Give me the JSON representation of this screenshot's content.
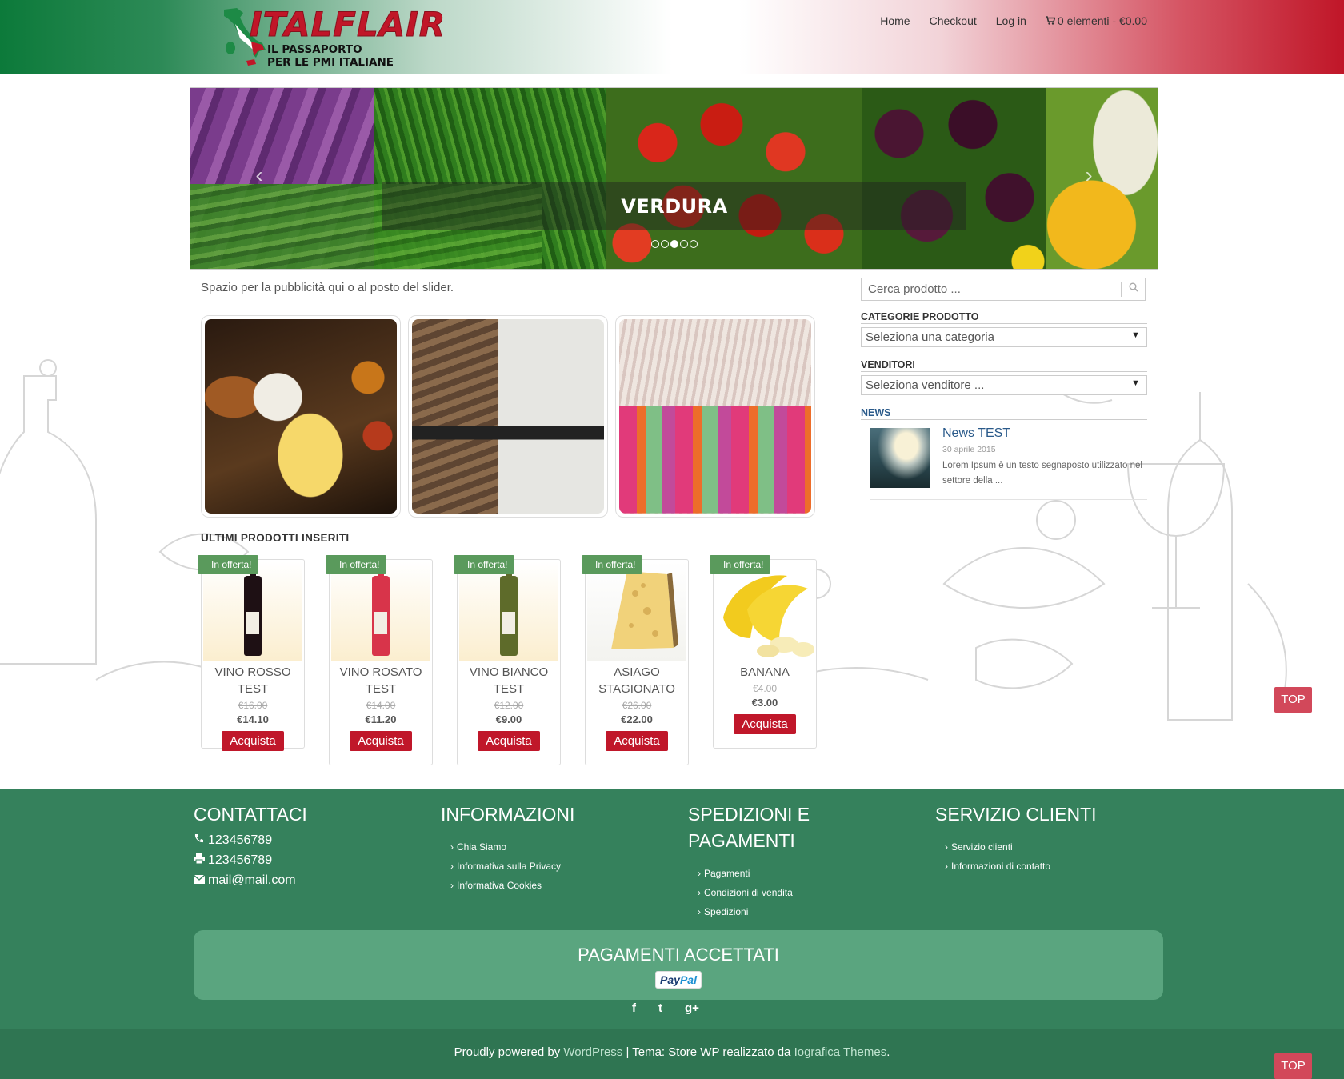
{
  "header": {
    "logo_title": "ITALFLAIR",
    "logo_sub1": "IL PASSAPORTO",
    "logo_sub2": "PER LE PMI ITALIANE",
    "nav": {
      "home": "Home",
      "checkout": "Checkout",
      "login": "Log in",
      "cart": "0 elementi - €0.00"
    }
  },
  "slider": {
    "caption": "VERDURA",
    "prev": "‹",
    "next": "›",
    "dots": 5,
    "active_dot": 3
  },
  "main": {
    "ad_text": "Spazio per la pubblicità qui o al posto del slider.",
    "section_title": "ULTIMI PRODOTTI INSERITI",
    "products": [
      {
        "badge": "In offerta!",
        "name": "VINO ROSSO TEST",
        "old_price": "€16.00",
        "price": "€14.10",
        "button": "Acquista"
      },
      {
        "badge": "In offerta!",
        "name": "VINO ROSATO TEST",
        "old_price": "€14.00",
        "price": "€11.20",
        "button": "Acquista"
      },
      {
        "badge": "In offerta!",
        "name": "VINO BIANCO TEST",
        "old_price": "€12.00",
        "price": "€9.00",
        "button": "Acquista"
      },
      {
        "badge": "In offerta!",
        "name": "ASIAGO STAGIONATO",
        "old_price": "€26.00",
        "price": "€22.00",
        "button": "Acquista"
      },
      {
        "badge": "In offerta!",
        "name": "BANANA",
        "old_price": "€4.00",
        "price": "€3.00",
        "button": "Acquista"
      }
    ]
  },
  "sidebar": {
    "search_placeholder": "Cerca prodotto ...",
    "categories_title": "CATEGORIE PRODOTTO",
    "categories_selected": "Seleziona una categoria",
    "vendors_title": "VENDITORI",
    "vendors_selected": "Seleziona venditore ...",
    "news_title": "NEWS",
    "news": {
      "title": "News TEST",
      "date": "30 aprile 2015",
      "excerpt": "Lorem Ipsum è un testo segnaposto utilizzato nel settore della ..."
    }
  },
  "top_label": "TOP",
  "footer": {
    "contact": {
      "title": "CONTATTACI",
      "phone": "123456789",
      "fax": "123456789",
      "email": "mail@mail.com"
    },
    "info": {
      "title": "INFORMAZIONI",
      "links": [
        "Chia Siamo",
        "Informativa sulla Privacy",
        "Informativa Cookies"
      ]
    },
    "shipping": {
      "title": "SPEDIZIONI E PAGAMENTI",
      "links": [
        "Pagamenti",
        "Condizioni di vendita",
        "Spedizioni"
      ]
    },
    "service": {
      "title": "SERVIZIO CLIENTI",
      "links": [
        "Servizio clienti",
        "Informazioni di contatto"
      ]
    },
    "payments_title": "PAGAMENTI ACCETTATI",
    "paypal": {
      "part1": "Pay",
      "part2": "Pal"
    },
    "social": {
      "facebook": "f",
      "twitter": "t",
      "googleplus": "g+"
    },
    "credits": {
      "prefix": "Proudly powered by ",
      "wordpress": "WordPress",
      "middle": " | Tema: Store WP realizzato da ",
      "iografica": "Iografica Themes",
      "suffix": "."
    }
  },
  "colors": {
    "brand_red": "#c0172a",
    "footer_green": "#35815c",
    "badge_green": "#5a9a5c",
    "top_button": "#d2485a"
  }
}
